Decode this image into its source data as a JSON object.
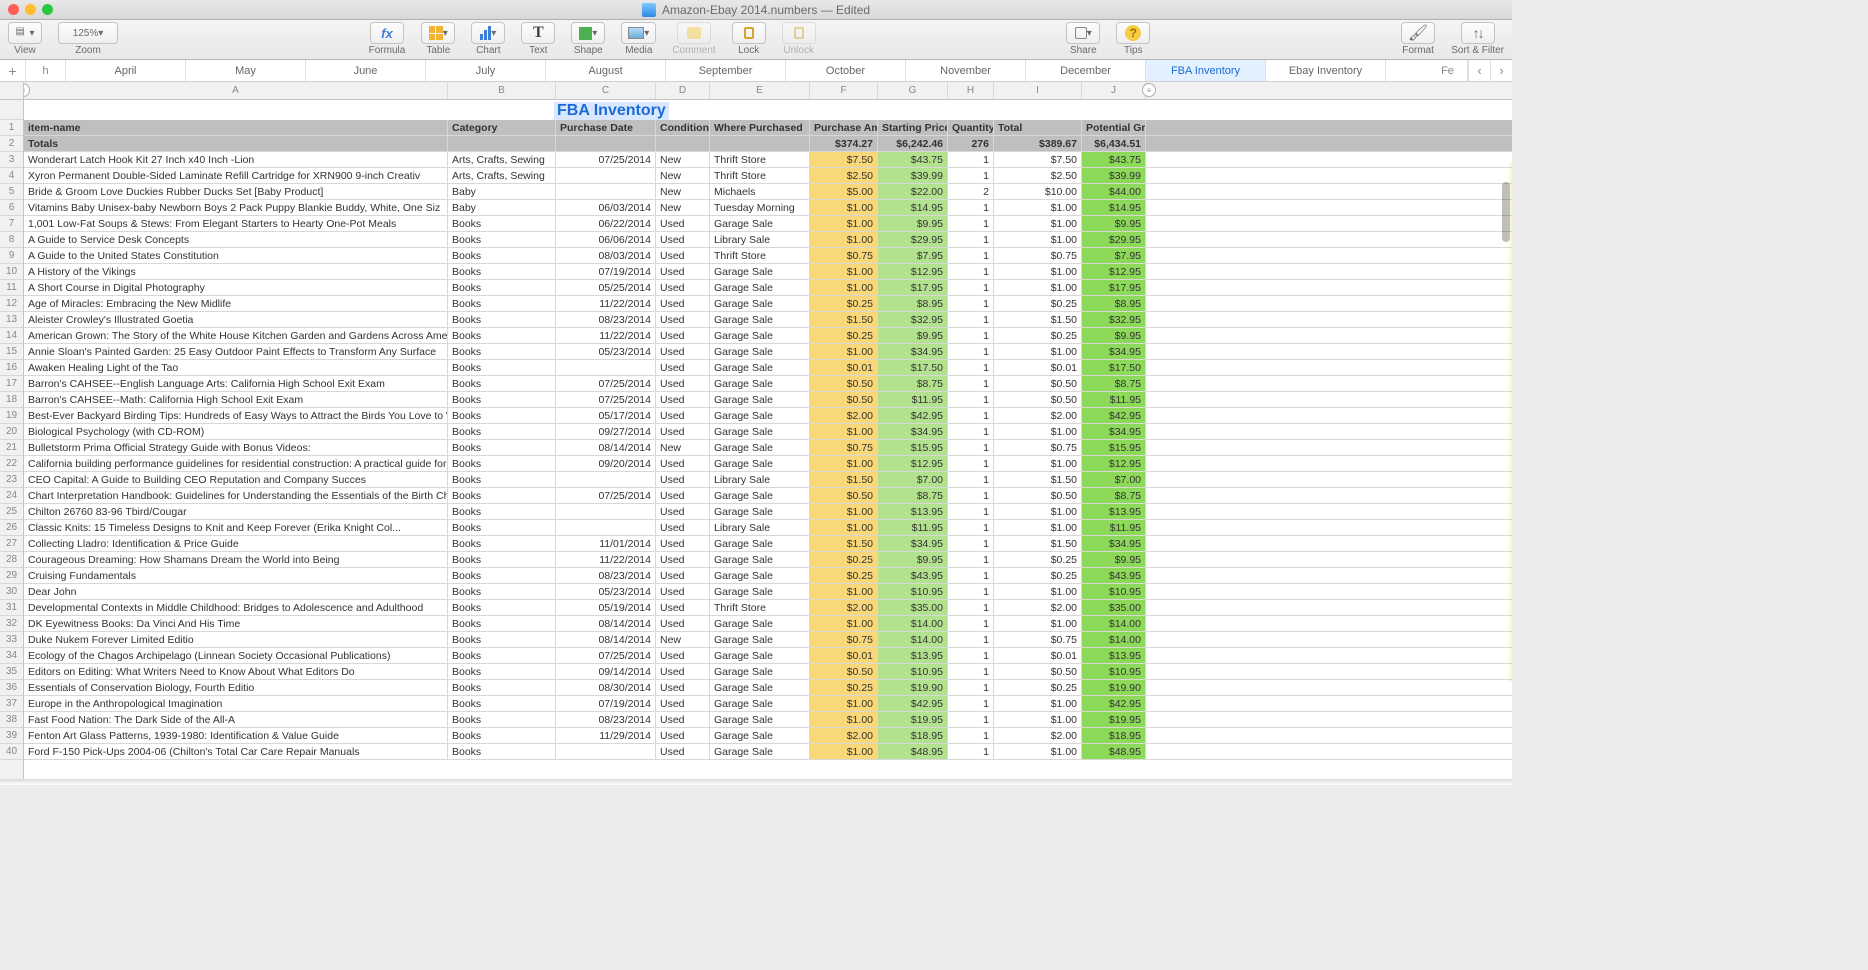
{
  "window": {
    "title": "Amazon-Ebay 2014.numbers",
    "status": "Edited"
  },
  "toolbar": {
    "view": "View",
    "zoom": "Zoom",
    "zoom_value": "125%",
    "formula": "Formula",
    "table": "Table",
    "chart": "Chart",
    "text": "Text",
    "shape": "Shape",
    "media": "Media",
    "comment": "Comment",
    "lock": "Lock",
    "unlock": "Unlock",
    "share": "Share",
    "tips": "Tips",
    "format": "Format",
    "sortfilter": "Sort & Filter"
  },
  "tabs": {
    "partial_left": "h",
    "list": [
      "April",
      "May",
      "June",
      "July",
      "August",
      "September",
      "October",
      "November",
      "December",
      "FBA Inventory",
      "Ebay Inventory"
    ],
    "partial_right": "Fe",
    "active": "FBA Inventory"
  },
  "columns_letters": [
    "A",
    "B",
    "C",
    "D",
    "E",
    "F",
    "G",
    "H",
    "I",
    "J"
  ],
  "sheet_title": "FBA Inventory",
  "headers": [
    "item-name",
    "Category",
    "Purchase Date",
    "Condition",
    "Where Purchased",
    "Purchase Amount",
    "Starting Price",
    "Quantity",
    "Total",
    "Potential Gross"
  ],
  "totals": {
    "label": "Totals",
    "amount": "$374.27",
    "start": "$6,242.46",
    "qty": "276",
    "total": "$389.67",
    "gross": "$6,434.51"
  },
  "rows": [
    {
      "n": "Wonderart Latch Hook Kit 27 Inch x40 Inch -Lion",
      "cat": "Arts, Crafts, Sewing",
      "date": "07/25/2014",
      "cond": "New",
      "where": "Thrift Store",
      "amt": "$7.50",
      "start": "$43.75",
      "qty": "1",
      "tot": "$7.50",
      "gross": "$43.75"
    },
    {
      "n": "Xyron Permanent Double-Sided Laminate Refill Cartridge for XRN900 9-inch Creativ",
      "cat": "Arts, Crafts, Sewing",
      "date": "",
      "cond": "New",
      "where": "Thrift Store",
      "amt": "$2.50",
      "start": "$39.99",
      "qty": "1",
      "tot": "$2.50",
      "gross": "$39.99"
    },
    {
      "n": "Bride & Groom Love Duckies Rubber Ducks Set [Baby Product]",
      "cat": "Baby",
      "date": "",
      "cond": "New",
      "where": "Michaels",
      "amt": "$5.00",
      "start": "$22.00",
      "qty": "2",
      "tot": "$10.00",
      "gross": "$44.00"
    },
    {
      "n": "Vitamins Baby Unisex-baby Newborn Boys 2 Pack Puppy Blankie Buddy, White, One Siz",
      "cat": "Baby",
      "date": "06/03/2014",
      "cond": "New",
      "where": "Tuesday Morning",
      "amt": "$1.00",
      "start": "$14.95",
      "qty": "1",
      "tot": "$1.00",
      "gross": "$14.95"
    },
    {
      "n": "1,001 Low-Fat Soups & Stews: From Elegant Starters to Hearty One-Pot Meals",
      "cat": "Books",
      "date": "06/22/2014",
      "cond": "Used",
      "where": "Garage Sale",
      "amt": "$1.00",
      "start": "$9.95",
      "qty": "1",
      "tot": "$1.00",
      "gross": "$9.95"
    },
    {
      "n": "A Guide to Service Desk Concepts",
      "cat": "Books",
      "date": "06/06/2014",
      "cond": "Used",
      "where": "Library Sale",
      "amt": "$1.00",
      "start": "$29.95",
      "qty": "1",
      "tot": "$1.00",
      "gross": "$29.95"
    },
    {
      "n": "A Guide to the United States Constitution",
      "cat": "Books",
      "date": "08/03/2014",
      "cond": "Used",
      "where": "Thrift Store",
      "amt": "$0.75",
      "start": "$7.95",
      "qty": "1",
      "tot": "$0.75",
      "gross": "$7.95"
    },
    {
      "n": "A History of the Vikings",
      "cat": "Books",
      "date": "07/19/2014",
      "cond": "Used",
      "where": "Garage Sale",
      "amt": "$1.00",
      "start": "$12.95",
      "qty": "1",
      "tot": "$1.00",
      "gross": "$12.95"
    },
    {
      "n": "A Short Course in Digital Photography",
      "cat": "Books",
      "date": "05/25/2014",
      "cond": "Used",
      "where": "Garage Sale",
      "amt": "$1.00",
      "start": "$17.95",
      "qty": "1",
      "tot": "$1.00",
      "gross": "$17.95"
    },
    {
      "n": "Age of Miracles: Embracing the New Midlife",
      "cat": "Books",
      "date": "11/22/2014",
      "cond": "Used",
      "where": "Garage Sale",
      "amt": "$0.25",
      "start": "$8.95",
      "qty": "1",
      "tot": "$0.25",
      "gross": "$8.95"
    },
    {
      "n": "Aleister Crowley's Illustrated Goetia",
      "cat": "Books",
      "date": "08/23/2014",
      "cond": "Used",
      "where": "Garage Sale",
      "amt": "$1.50",
      "start": "$32.95",
      "qty": "1",
      "tot": "$1.50",
      "gross": "$32.95"
    },
    {
      "n": "American Grown: The Story of the White House Kitchen Garden and Gardens Across America",
      "cat": "Books",
      "date": "11/22/2014",
      "cond": "Used",
      "where": "Garage Sale",
      "amt": "$0.25",
      "start": "$9.95",
      "qty": "1",
      "tot": "$0.25",
      "gross": "$9.95"
    },
    {
      "n": "Annie Sloan's Painted Garden: 25 Easy Outdoor Paint Effects to Transform Any Surface",
      "cat": "Books",
      "date": "05/23/2014",
      "cond": "Used",
      "where": "Garage Sale",
      "amt": "$1.00",
      "start": "$34.95",
      "qty": "1",
      "tot": "$1.00",
      "gross": "$34.95"
    },
    {
      "n": "Awaken Healing Light of the Tao",
      "cat": "Books",
      "date": "",
      "cond": "Used",
      "where": "Garage Sale",
      "amt": "$0.01",
      "start": "$17.50",
      "qty": "1",
      "tot": "$0.01",
      "gross": "$17.50"
    },
    {
      "n": "Barron's CAHSEE--English Language Arts: California High School Exit Exam",
      "cat": "Books",
      "date": "07/25/2014",
      "cond": "Used",
      "where": "Garage Sale",
      "amt": "$0.50",
      "start": "$8.75",
      "qty": "1",
      "tot": "$0.50",
      "gross": "$8.75"
    },
    {
      "n": "Barron's CAHSEE--Math: California High School Exit Exam",
      "cat": "Books",
      "date": "07/25/2014",
      "cond": "Used",
      "where": "Garage Sale",
      "amt": "$0.50",
      "start": "$11.95",
      "qty": "1",
      "tot": "$0.50",
      "gross": "$11.95"
    },
    {
      "n": "Best-Ever Backyard Birding Tips: Hundreds of Easy Ways to Attract the Birds You Love to Watch",
      "cat": "Books",
      "date": "05/17/2014",
      "cond": "Used",
      "where": "Garage Sale",
      "amt": "$2.00",
      "start": "$42.95",
      "qty": "1",
      "tot": "$2.00",
      "gross": "$42.95"
    },
    {
      "n": "Biological Psychology (with CD-ROM)",
      "cat": "Books",
      "date": "09/27/2014",
      "cond": "Used",
      "where": "Garage Sale",
      "amt": "$1.00",
      "start": "$34.95",
      "qty": "1",
      "tot": "$1.00",
      "gross": "$34.95"
    },
    {
      "n": "Bulletstorm Prima Official Strategy Guide with Bonus Videos:",
      "cat": "Books",
      "date": "08/14/2014",
      "cond": "New",
      "where": "Garage Sale",
      "amt": "$0.75",
      "start": "$15.95",
      "qty": "1",
      "tot": "$0.75",
      "gross": "$15.95"
    },
    {
      "n": "California building performance guidelines for residential construction: A practical guide for owners of new homes : constr",
      "cat": "Books",
      "date": "09/20/2014",
      "cond": "Used",
      "where": "Garage Sale",
      "amt": "$1.00",
      "start": "$12.95",
      "qty": "1",
      "tot": "$1.00",
      "gross": "$12.95"
    },
    {
      "n": "CEO Capital: A Guide to Building CEO Reputation and Company Succes",
      "cat": "Books",
      "date": "",
      "cond": "Used",
      "where": "Library Sale",
      "amt": "$1.50",
      "start": "$7.00",
      "qty": "1",
      "tot": "$1.50",
      "gross": "$7.00"
    },
    {
      "n": "Chart Interpretation Handbook: Guidelines for Understanding the Essentials of the Birth Chart",
      "cat": "Books",
      "date": "07/25/2014",
      "cond": "Used",
      "where": "Garage Sale",
      "amt": "$0.50",
      "start": "$8.75",
      "qty": "1",
      "tot": "$0.50",
      "gross": "$8.75"
    },
    {
      "n": "Chilton 26760 83-96 Tbird/Cougar",
      "cat": "Books",
      "date": "",
      "cond": "Used",
      "where": "Garage Sale",
      "amt": "$1.00",
      "start": "$13.95",
      "qty": "1",
      "tot": "$1.00",
      "gross": "$13.95"
    },
    {
      "n": "Classic Knits: 15 Timeless Designs to Knit and Keep Forever (Erika Knight Col...",
      "cat": "Books",
      "date": "",
      "cond": "Used",
      "where": "Library Sale",
      "amt": "$1.00",
      "start": "$11.95",
      "qty": "1",
      "tot": "$1.00",
      "gross": "$11.95"
    },
    {
      "n": "Collecting Lladro: Identification & Price Guide",
      "cat": "Books",
      "date": "11/01/2014",
      "cond": "Used",
      "where": "Garage Sale",
      "amt": "$1.50",
      "start": "$34.95",
      "qty": "1",
      "tot": "$1.50",
      "gross": "$34.95"
    },
    {
      "n": "Courageous Dreaming: How Shamans Dream the World into Being",
      "cat": "Books",
      "date": "11/22/2014",
      "cond": "Used",
      "where": "Garage Sale",
      "amt": "$0.25",
      "start": "$9.95",
      "qty": "1",
      "tot": "$0.25",
      "gross": "$9.95"
    },
    {
      "n": "Cruising Fundamentals",
      "cat": "Books",
      "date": "08/23/2014",
      "cond": "Used",
      "where": "Garage Sale",
      "amt": "$0.25",
      "start": "$43.95",
      "qty": "1",
      "tot": "$0.25",
      "gross": "$43.95"
    },
    {
      "n": "Dear John",
      "cat": "Books",
      "date": "05/23/2014",
      "cond": "Used",
      "where": "Garage Sale",
      "amt": "$1.00",
      "start": "$10.95",
      "qty": "1",
      "tot": "$1.00",
      "gross": "$10.95"
    },
    {
      "n": "Developmental Contexts in Middle Childhood: Bridges to Adolescence and Adulthood",
      "cat": "Books",
      "date": "05/19/2014",
      "cond": "Used",
      "where": "Thrift Store",
      "amt": "$2.00",
      "start": "$35.00",
      "qty": "1",
      "tot": "$2.00",
      "gross": "$35.00"
    },
    {
      "n": "DK Eyewitness Books: Da Vinci And His Time",
      "cat": "Books",
      "date": "08/14/2014",
      "cond": "Used",
      "where": "Garage Sale",
      "amt": "$1.00",
      "start": "$14.00",
      "qty": "1",
      "tot": "$1.00",
      "gross": "$14.00"
    },
    {
      "n": "Duke Nukem Forever Limited Editio",
      "cat": "Books",
      "date": "08/14/2014",
      "cond": "New",
      "where": "Garage Sale",
      "amt": "$0.75",
      "start": "$14.00",
      "qty": "1",
      "tot": "$0.75",
      "gross": "$14.00"
    },
    {
      "n": "Ecology of the Chagos Archipelago (Linnean Society Occasional Publications)",
      "cat": "Books",
      "date": "07/25/2014",
      "cond": "Used",
      "where": "Garage Sale",
      "amt": "$0.01",
      "start": "$13.95",
      "qty": "1",
      "tot": "$0.01",
      "gross": "$13.95"
    },
    {
      "n": "Editors on Editing: What Writers Need to Know About What Editors Do",
      "cat": "Books",
      "date": "09/14/2014",
      "cond": "Used",
      "where": "Garage Sale",
      "amt": "$0.50",
      "start": "$10.95",
      "qty": "1",
      "tot": "$0.50",
      "gross": "$10.95"
    },
    {
      "n": "Essentials of Conservation Biology, Fourth Editio",
      "cat": "Books",
      "date": "08/30/2014",
      "cond": "Used",
      "where": "Garage Sale",
      "amt": "$0.25",
      "start": "$19.90",
      "qty": "1",
      "tot": "$0.25",
      "gross": "$19.90"
    },
    {
      "n": "Europe in the Anthropological Imagination",
      "cat": "Books",
      "date": "07/19/2014",
      "cond": "Used",
      "where": "Garage Sale",
      "amt": "$1.00",
      "start": "$42.95",
      "qty": "1",
      "tot": "$1.00",
      "gross": "$42.95"
    },
    {
      "n": "Fast Food Nation: The Dark Side of the All-A",
      "cat": "Books",
      "date": "08/23/2014",
      "cond": "Used",
      "where": "Garage Sale",
      "amt": "$1.00",
      "start": "$19.95",
      "qty": "1",
      "tot": "$1.00",
      "gross": "$19.95"
    },
    {
      "n": "Fenton Art Glass Patterns, 1939-1980: Identification & Value Guide",
      "cat": "Books",
      "date": "11/29/2014",
      "cond": "Used",
      "where": "Garage Sale",
      "amt": "$2.00",
      "start": "$18.95",
      "qty": "1",
      "tot": "$2.00",
      "gross": "$18.95"
    },
    {
      "n": "Ford F-150 Pick-Ups 2004-06 (Chilton's Total Car Care Repair Manuals",
      "cat": "Books",
      "date": "",
      "cond": "Used",
      "where": "Garage Sale",
      "amt": "$1.00",
      "start": "$48.95",
      "qty": "1",
      "tot": "$1.00",
      "gross": "$48.95"
    }
  ]
}
